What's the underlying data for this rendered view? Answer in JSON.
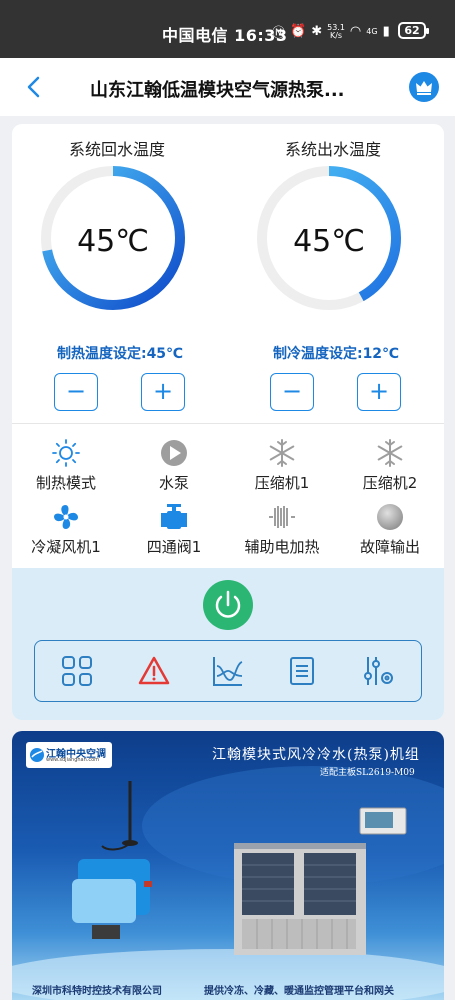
{
  "status_bar": {
    "carrier_time": "中国电信 16:33",
    "net_speed_value": "53.1",
    "net_speed_unit": "K/s",
    "signal_label": "4G",
    "battery": "62"
  },
  "navbar": {
    "title": "山东江翰低温模块空气源热泵..."
  },
  "gauges": [
    {
      "title": "系统回水温度",
      "value": "45℃",
      "fill_fraction": 0.72,
      "setpoint": "制热温度设定:45℃"
    },
    {
      "title": "系统出水温度",
      "value": "45℃",
      "fill_fraction": 0.42,
      "setpoint": "制冷温度设定:12℃"
    }
  ],
  "stepper": {
    "minus": "−",
    "plus": "+"
  },
  "status_items": [
    {
      "label": "制热模式",
      "icon": "sun-icon"
    },
    {
      "label": "水泵",
      "icon": "pump-icon"
    },
    {
      "label": "压缩机1",
      "icon": "snowflake-icon"
    },
    {
      "label": "压缩机2",
      "icon": "snowflake-icon"
    },
    {
      "label": "冷凝风机1",
      "icon": "fan-icon"
    },
    {
      "label": "四通阀1",
      "icon": "valve-icon"
    },
    {
      "label": "辅助电加热",
      "icon": "heater-icon"
    },
    {
      "label": "故障输出",
      "icon": "fault-dot-icon"
    }
  ],
  "toolbar": {
    "items": [
      "grid-icon",
      "warning-icon",
      "curve-chart-icon",
      "list-icon",
      "settings-sliders-icon"
    ]
  },
  "banner": {
    "logo_name": "江翰中央空调",
    "logo_site": "www.sdjianghan.com",
    "heading": "江翰模块式风冷冷水(热泵)机组",
    "subheading": "适配主板SL2619-M09",
    "footer_left": "深圳市科特时控技术有限公司",
    "footer_right": "提供冷冻、冷藏、暖通监控管理平台和网关"
  },
  "colors": {
    "accent": "#1e88e5",
    "power": "#2bb673",
    "control_bg": "#d9ecf8",
    "warning": "#e53935"
  }
}
